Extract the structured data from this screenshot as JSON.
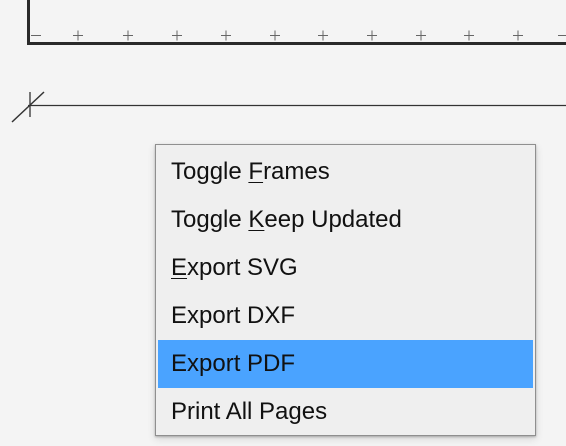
{
  "canvas": {
    "background": "#f4f4f4",
    "line_color": "#2a2a2a"
  },
  "context_menu": {
    "items": [
      {
        "pre": "Toggle ",
        "key": "F",
        "post": "rames",
        "selected": false
      },
      {
        "pre": "Toggle ",
        "key": "K",
        "post": "eep Updated",
        "selected": false
      },
      {
        "pre": "",
        "key": "E",
        "post": "xport SVG",
        "selected": false
      },
      {
        "pre": "",
        "key": "",
        "post": "Export DXF",
        "selected": false
      },
      {
        "pre": "",
        "key": "",
        "post": "Export PDF",
        "selected": true
      },
      {
        "pre": "",
        "key": "",
        "post": "Print All Pages",
        "selected": false
      }
    ],
    "selected_color": "#4aa3ff"
  }
}
